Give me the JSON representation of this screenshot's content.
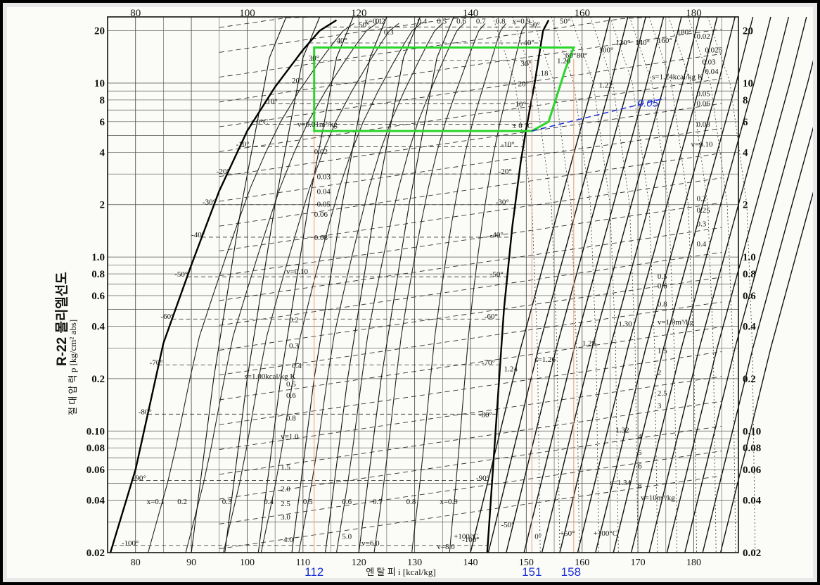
{
  "chart_data": {
    "type": "line",
    "title": "R-22 몰리엘선도",
    "xlabel": "엔  탈  피  i  [kcal/kg]",
    "ylabel": "절  대  압  력  p  [kg/cm² abs]",
    "x_scale": "linear",
    "y_scale": "log",
    "xlim": [
      75,
      188
    ],
    "ylim": [
      0.02,
      24
    ],
    "grid": true,
    "x_ticks": [
      80,
      90,
      100,
      110,
      120,
      130,
      140,
      150,
      160,
      170,
      180
    ],
    "x_ticks_top": [
      80,
      100,
      120,
      140,
      160,
      180
    ],
    "y_ticks": [
      {
        "value": 20,
        "label": "20"
      },
      {
        "value": 10,
        "label": "10"
      },
      {
        "value": 8,
        "label": "8"
      },
      {
        "value": 6,
        "label": "6"
      },
      {
        "value": 4,
        "label": "4"
      },
      {
        "value": 2,
        "label": "2"
      },
      {
        "value": 1.0,
        "label": "1.0"
      },
      {
        "value": 0.8,
        "label": "0.8"
      },
      {
        "value": 0.6,
        "label": "0.6"
      },
      {
        "value": 0.4,
        "label": "0.4"
      },
      {
        "value": 0.2,
        "label": "0.2"
      },
      {
        "value": 0.1,
        "label": "0.10"
      },
      {
        "value": 0.08,
        "label": "0.08"
      },
      {
        "value": 0.06,
        "label": "0.06"
      },
      {
        "value": 0.04,
        "label": "0.04"
      },
      {
        "value": 0.02,
        "label": "0.02"
      }
    ],
    "saturated_liquid": [
      [
        75.5,
        0.02
      ],
      [
        80,
        0.06
      ],
      [
        85,
        0.32
      ],
      [
        90,
        0.9
      ],
      [
        95,
        2.4
      ],
      [
        100,
        5.3
      ],
      [
        105,
        9.5
      ],
      [
        110,
        15.5
      ],
      [
        113,
        20
      ],
      [
        116,
        23
      ]
    ],
    "saturated_vapor": [
      [
        143,
        0.02
      ],
      [
        144.5,
        0.1
      ],
      [
        146,
        0.5
      ],
      [
        147.5,
        1.5
      ],
      [
        149,
        3.5
      ],
      [
        150,
        5.5
      ],
      [
        151.5,
        10
      ],
      [
        153,
        20
      ],
      [
        154,
        23
      ]
    ],
    "temperature_labels": [
      {
        "text": "50°",
        "x": 120,
        "p": 21
      },
      {
        "text": "40°",
        "x": 116,
        "p": 17
      },
      {
        "text": "30°",
        "x": 111,
        "p": 13.5
      },
      {
        "text": "20°",
        "x": 108,
        "p": 10
      },
      {
        "text": "10°",
        "x": 103.5,
        "p": 7.6
      },
      {
        "text": "± 0°C",
        "x": 100.5,
        "p": 5.8
      },
      {
        "text": "-10°",
        "x": 98,
        "p": 4.3
      },
      {
        "text": "-20°",
        "x": 94.5,
        "p": 3.0
      },
      {
        "text": "-30°",
        "x": 92,
        "p": 2.0
      },
      {
        "text": "-40°",
        "x": 90,
        "p": 1.3
      },
      {
        "text": "-50°",
        "x": 87,
        "p": 0.77
      },
      {
        "text": "-60°",
        "x": 84.5,
        "p": 0.44
      },
      {
        "text": "-70°",
        "x": 82.5,
        "p": 0.24
      },
      {
        "text": "-80°",
        "x": 80.5,
        "p": 0.125
      },
      {
        "text": "-90°",
        "x": 79.5,
        "p": 0.052
      },
      {
        "text": "-100°",
        "x": 77.5,
        "p": 0.022
      },
      {
        "text": "50°",
        "x": 150.5,
        "p": 21
      },
      {
        "text": "40°",
        "x": 149.5,
        "p": 16.5
      },
      {
        "text": "30°",
        "x": 149,
        "p": 12.5
      },
      {
        "text": "20°",
        "x": 148.5,
        "p": 9.6
      },
      {
        "text": "10°",
        "x": 148,
        "p": 7.3
      },
      {
        "text": "± 0 °C",
        "x": 147.5,
        "p": 5.5
      },
      {
        "text": "-10°",
        "x": 145.5,
        "p": 4.3
      },
      {
        "text": "-20°",
        "x": 145,
        "p": 3.0
      },
      {
        "text": "-30°",
        "x": 144.5,
        "p": 2.0
      },
      {
        "text": "-40°",
        "x": 143.5,
        "p": 1.3
      },
      {
        "text": "-50°",
        "x": 143.5,
        "p": 0.77
      },
      {
        "text": "-60°",
        "x": 142.5,
        "p": 0.44
      },
      {
        "text": "-70°",
        "x": 142,
        "p": 0.24
      },
      {
        "text": "-80°",
        "x": 141.5,
        "p": 0.12
      },
      {
        "text": "-90°",
        "x": 141,
        "p": 0.052
      },
      {
        "text": "-100°",
        "x": 138.5,
        "p": 0.023
      }
    ],
    "quality_labels": [
      {
        "text": "x=0.1",
        "x": 121,
        "p": 22
      },
      {
        "text": "0.2",
        "x": 123,
        "p": 22
      },
      {
        "text": "0.3",
        "x": 124.5,
        "p": 19
      },
      {
        "text": "0.4",
        "x": 130.5,
        "p": 22
      },
      {
        "text": "0.5",
        "x": 134,
        "p": 22
      },
      {
        "text": "0.6",
        "x": 137.5,
        "p": 22
      },
      {
        "text": "0.7",
        "x": 141,
        "p": 22
      },
      {
        "text": "0.8",
        "x": 144.5,
        "p": 22
      },
      {
        "text": "x=0.9",
        "x": 147.5,
        "p": 22
      },
      {
        "text": "x=0.1",
        "x": 82,
        "p": 0.038
      },
      {
        "text": "0.2",
        "x": 87.5,
        "p": 0.038
      },
      {
        "text": "0.3",
        "x": 95.5,
        "p": 0.038
      },
      {
        "text": "0.4",
        "x": 103,
        "p": 0.038
      },
      {
        "text": "0.5",
        "x": 110,
        "p": 0.038
      },
      {
        "text": "0.6",
        "x": 117,
        "p": 0.038
      },
      {
        "text": "0.7",
        "x": 122.5,
        "p": 0.038
      },
      {
        "text": "0.8",
        "x": 128.5,
        "p": 0.038
      },
      {
        "text": "x=0.9",
        "x": 134.5,
        "p": 0.038
      }
    ],
    "volume_labels": [
      {
        "text": "v=0.01m³/kg",
        "x": 109,
        "p": 5.6
      },
      {
        "text": "0.02",
        "x": 112,
        "p": 3.9
      },
      {
        "text": "0.03",
        "x": 112.5,
        "p": 2.8
      },
      {
        "text": "0.04",
        "x": 112.5,
        "p": 2.3
      },
      {
        "text": "0.05",
        "x": 112.5,
        "p": 1.95
      },
      {
        "text": "0.06",
        "x": 112,
        "p": 1.7
      },
      {
        "text": "0.08",
        "x": 112,
        "p": 1.25
      },
      {
        "text": "v=0.10",
        "x": 107,
        "p": 0.8
      },
      {
        "text": "0.2",
        "x": 107.5,
        "p": 0.42
      },
      {
        "text": "0.3",
        "x": 107.5,
        "p": 0.3
      },
      {
        "text": "0.4",
        "x": 108,
        "p": 0.23
      },
      {
        "text": "0.5",
        "x": 107,
        "p": 0.18
      },
      {
        "text": "0.6",
        "x": 107,
        "p": 0.155
      },
      {
        "text": "0.8",
        "x": 107,
        "p": 0.115
      },
      {
        "text": "v=1.0",
        "x": 106,
        "p": 0.09
      },
      {
        "text": "1.5",
        "x": 106,
        "p": 0.06
      },
      {
        "text": "2.0",
        "x": 106,
        "p": 0.045
      },
      {
        "text": "2.5",
        "x": 106,
        "p": 0.037
      },
      {
        "text": "3.0",
        "x": 106,
        "p": 0.031
      },
      {
        "text": "4.0",
        "x": 106.5,
        "p": 0.023
      },
      {
        "text": "5.0",
        "x": 117,
        "p": 0.024
      },
      {
        "text": "v=6.0",
        "x": 120.5,
        "p": 0.022
      },
      {
        "text": "v=8.0",
        "x": 134,
        "p": 0.021
      },
      {
        "text": "0.02",
        "x": 180.5,
        "p": 18
      },
      {
        "text": "0.025",
        "x": 182,
        "p": 15
      },
      {
        "text": "0.03",
        "x": 181.5,
        "p": 12.8
      },
      {
        "text": "0.04",
        "x": 182,
        "p": 11.3
      },
      {
        "text": "0.05",
        "x": 180.5,
        "p": 8.4
      },
      {
        "text": "0.06",
        "x": 180.5,
        "p": 7.4
      },
      {
        "text": "0.08",
        "x": 180.5,
        "p": 5.6
      },
      {
        "text": "v=0.10",
        "x": 179.5,
        "p": 4.3
      },
      {
        "text": "0.2",
        "x": 180.5,
        "p": 2.1
      },
      {
        "text": "0.25",
        "x": 180.5,
        "p": 1.8
      },
      {
        "text": "0.3",
        "x": 180.5,
        "p": 1.5
      },
      {
        "text": "0.4",
        "x": 180.5,
        "p": 1.15
      },
      {
        "text": "0.5",
        "x": 173.5,
        "p": 0.75
      },
      {
        "text": "0.6",
        "x": 173.5,
        "p": 0.66
      },
      {
        "text": "0.8",
        "x": 173.5,
        "p": 0.52
      },
      {
        "text": "v=1.0m³/kg",
        "x": 173.5,
        "p": 0.41
      },
      {
        "text": "1.5",
        "x": 173.5,
        "p": 0.28
      },
      {
        "text": "2",
        "x": 173.5,
        "p": 0.21
      },
      {
        "text": "2.5",
        "x": 173.5,
        "p": 0.16
      },
      {
        "text": "3",
        "x": 173.5,
        "p": 0.135
      },
      {
        "text": "4",
        "x": 170,
        "p": 0.09
      },
      {
        "text": "5",
        "x": 170,
        "p": 0.073
      },
      {
        "text": "6",
        "x": 170,
        "p": 0.061
      },
      {
        "text": "8",
        "x": 170,
        "p": 0.047
      },
      {
        "text": "v=10m³/kg",
        "x": 170.5,
        "p": 0.04
      }
    ],
    "entropy_labels": [
      {
        "text": "s=1.00kcal/kg K",
        "x": 99.5,
        "p": 0.2
      },
      {
        "text": "1.18",
        "x": 151.5,
        "p": 11
      },
      {
        "text": "1.20",
        "x": 155.5,
        "p": 13
      },
      {
        "text": "1.22",
        "x": 163,
        "p": 9.4
      },
      {
        "text": "s=1.24kcal/kg K",
        "x": 172.5,
        "p": 10.5
      },
      {
        "text": "1.24",
        "x": 146,
        "p": 0.22
      },
      {
        "text": "s=1.26",
        "x": 151.5,
        "p": 0.25
      },
      {
        "text": "1.28",
        "x": 160,
        "p": 0.31
      },
      {
        "text": "1.30",
        "x": 166.5,
        "p": 0.4
      },
      {
        "text": "1.32",
        "x": 166,
        "p": 0.098
      },
      {
        "text": "s=1.34",
        "x": 165,
        "p": 0.049
      }
    ],
    "superheat_temperature_labels": [
      {
        "text": "50°",
        "x": 156,
        "p": 22
      },
      {
        "text": "60°",
        "x": 157,
        "p": 14
      },
      {
        "text": "80°",
        "x": 159,
        "p": 14
      },
      {
        "text": "100°",
        "x": 163,
        "p": 15
      },
      {
        "text": "120°",
        "x": 166,
        "p": 16.5
      },
      {
        "text": "140°",
        "x": 169.5,
        "p": 16.5
      },
      {
        "text": "160°",
        "x": 173.5,
        "p": 17
      },
      {
        "text": "180°",
        "x": 177,
        "p": 19
      },
      {
        "text": "-50°",
        "x": 145.5,
        "p": 0.028
      },
      {
        "text": "0°",
        "x": 151.5,
        "p": 0.024
      },
      {
        "text": "+50°",
        "x": 156,
        "p": 0.025
      },
      {
        "text": "+100°C",
        "x": 162,
        "p": 0.025
      },
      {
        "text": "+100°C",
        "x": 137,
        "p": 0.024
      }
    ],
    "annotations": {
      "cycle_outline_green": [
        [
          112,
          16
        ],
        [
          158.5,
          16
        ],
        [
          157,
          12
        ],
        [
          154,
          6
        ],
        [
          151,
          5.3
        ],
        [
          112,
          5.3
        ]
      ],
      "blue_line": {
        "from": [
          151,
          5.3
        ],
        "to": [
          175,
          8.2
        ],
        "label": "0.05"
      },
      "orange_verticals": [
        112,
        151,
        158.5
      ],
      "handwritten_x": [
        {
          "text": "112",
          "x": 112
        },
        {
          "text": "151",
          "x": 151
        },
        {
          "text": "158",
          "x": 158
        }
      ]
    }
  }
}
